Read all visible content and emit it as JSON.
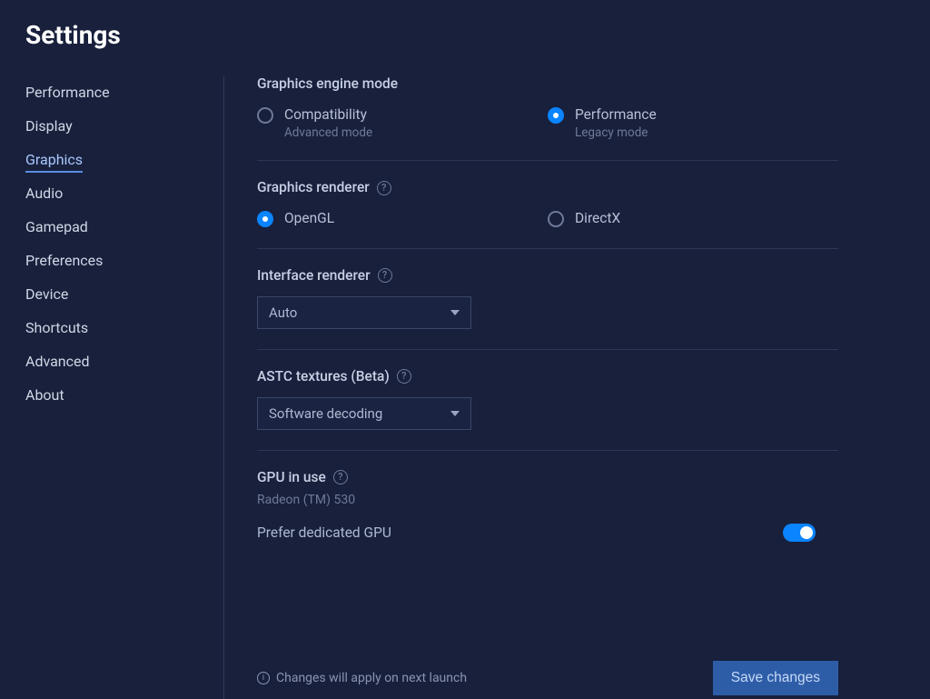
{
  "title": "Settings",
  "sidebar": {
    "items": [
      {
        "label": "Performance"
      },
      {
        "label": "Display"
      },
      {
        "label": "Graphics",
        "active": true
      },
      {
        "label": "Audio"
      },
      {
        "label": "Gamepad"
      },
      {
        "label": "Preferences"
      },
      {
        "label": "Device"
      },
      {
        "label": "Shortcuts"
      },
      {
        "label": "Advanced"
      },
      {
        "label": "About"
      }
    ]
  },
  "graphics_engine": {
    "title": "Graphics engine mode",
    "options": [
      {
        "label": "Compatibility",
        "sublabel": "Advanced mode",
        "selected": false
      },
      {
        "label": "Performance",
        "sublabel": "Legacy mode",
        "selected": true
      }
    ]
  },
  "graphics_renderer": {
    "title": "Graphics renderer",
    "options": [
      {
        "label": "OpenGL",
        "selected": true
      },
      {
        "label": "DirectX",
        "selected": false
      }
    ]
  },
  "interface_renderer": {
    "title": "Interface renderer",
    "selected": "Auto"
  },
  "astc_textures": {
    "title": "ASTC textures (Beta)",
    "selected": "Software decoding"
  },
  "gpu": {
    "title": "GPU in use",
    "name": "Radeon (TM) 530",
    "prefer_dedicated_label": "Prefer dedicated GPU",
    "prefer_dedicated": true
  },
  "footer": {
    "note": "Changes will apply on next launch",
    "save_label": "Save changes"
  },
  "colors": {
    "background": "#18203c",
    "accent": "#0a84ff",
    "button": "#2e5da8"
  }
}
